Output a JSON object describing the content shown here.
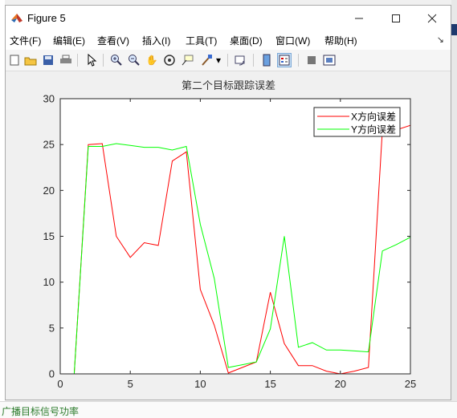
{
  "window": {
    "title": "Figure 5",
    "minimize_icon": "minimize-icon",
    "maximize_icon": "maximize-icon",
    "close_icon": "close-icon"
  },
  "menu": {
    "items": [
      "文件(F)",
      "编辑(E)",
      "查看(V)",
      "插入(I)",
      "工具(T)",
      "桌面(D)",
      "窗口(W)",
      "帮助(H)"
    ],
    "overflow_icon": "chevron-icon"
  },
  "toolbar": {
    "icons": [
      "new-figure-icon",
      "open-icon",
      "save-icon",
      "print-icon",
      "pointer-icon",
      "zoom-in-icon",
      "zoom-out-icon",
      "pan-icon",
      "rotate-icon",
      "data-cursor-icon",
      "brush-icon",
      "link-plot-icon",
      "colorbar-icon",
      "legend-icon",
      "hide-plot-tools-icon",
      "show-plot-tools-icon"
    ]
  },
  "background": {
    "bottom_text": "广播目标信号功率"
  },
  "colors": {
    "x_series": "#ff0000",
    "y_series": "#00ff00",
    "axes": "#262626",
    "window_bg": "#f0f0f0"
  },
  "chart_data": {
    "type": "line",
    "title": "第二个目标跟踪误差",
    "xlabel": "",
    "ylabel": "",
    "xlim": [
      0,
      25
    ],
    "ylim": [
      0,
      30
    ],
    "xticks": [
      "0",
      "5",
      "10",
      "15",
      "20",
      "25"
    ],
    "yticks": [
      "0",
      "5",
      "10",
      "15",
      "20",
      "25",
      "30"
    ],
    "grid": false,
    "legend_position": "top-right",
    "series": [
      {
        "name": "X方向误差",
        "color": "#ff0000",
        "x": [
          1,
          2,
          3,
          4,
          5,
          6,
          7,
          8,
          9,
          10,
          11,
          12,
          13,
          14,
          15,
          16,
          17,
          18,
          19,
          20,
          21,
          22,
          23,
          24,
          25
        ],
        "y": [
          0,
          25.0,
          25.1,
          15.0,
          12.7,
          14.3,
          14.0,
          23.2,
          24.2,
          9.2,
          5.3,
          0.1,
          0.7,
          1.3,
          8.9,
          3.3,
          0.9,
          0.9,
          0.3,
          0.0,
          0.3,
          0.7,
          26.6,
          26.6,
          27.1
        ]
      },
      {
        "name": "Y方向误差",
        "color": "#00ff00",
        "x": [
          1,
          2,
          3,
          4,
          5,
          6,
          7,
          8,
          9,
          10,
          11,
          12,
          13,
          14,
          15,
          16,
          17,
          18,
          19,
          20,
          21,
          22,
          23,
          24,
          25
        ],
        "y": [
          0,
          24.8,
          24.8,
          25.1,
          24.9,
          24.7,
          24.7,
          24.4,
          24.8,
          16.3,
          10.4,
          0.7,
          1.0,
          1.3,
          4.9,
          15.0,
          2.9,
          3.4,
          2.6,
          2.6,
          2.5,
          2.4,
          13.4,
          14.1,
          14.9
        ]
      }
    ]
  }
}
